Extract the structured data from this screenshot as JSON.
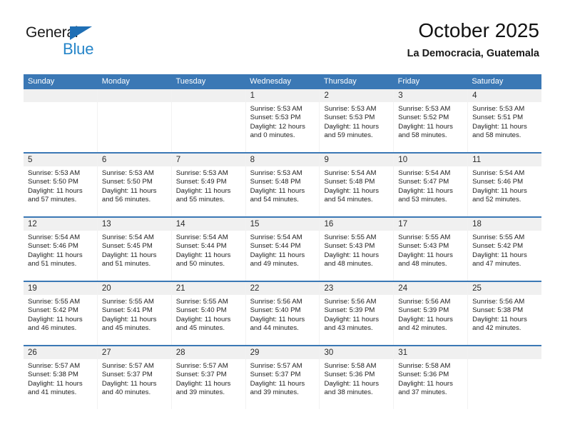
{
  "brand": {
    "name_top": "General",
    "name_bottom": "Blue",
    "color_dark": "#1b1b1b",
    "color_blue": "#2585c9",
    "triangle_color": "#1f6fb5"
  },
  "header": {
    "month_title": "October 2025",
    "location": "La Democracia, Guatemala"
  },
  "theme": {
    "header_band": "#3b78b5",
    "cell_head": "#f0f0f0",
    "cell_body": "#ffffff",
    "week_divider": "#3b78b5"
  },
  "calendar": {
    "weekday_headers": [
      "Sunday",
      "Monday",
      "Tuesday",
      "Wednesday",
      "Thursday",
      "Friday",
      "Saturday"
    ],
    "weeks": [
      [
        {
          "day": "",
          "lines": []
        },
        {
          "day": "",
          "lines": []
        },
        {
          "day": "",
          "lines": []
        },
        {
          "day": "1",
          "lines": [
            "Sunrise: 5:53 AM",
            "Sunset: 5:53 PM",
            "Daylight: 12 hours",
            "and 0 minutes."
          ]
        },
        {
          "day": "2",
          "lines": [
            "Sunrise: 5:53 AM",
            "Sunset: 5:53 PM",
            "Daylight: 11 hours",
            "and 59 minutes."
          ]
        },
        {
          "day": "3",
          "lines": [
            "Sunrise: 5:53 AM",
            "Sunset: 5:52 PM",
            "Daylight: 11 hours",
            "and 58 minutes."
          ]
        },
        {
          "day": "4",
          "lines": [
            "Sunrise: 5:53 AM",
            "Sunset: 5:51 PM",
            "Daylight: 11 hours",
            "and 58 minutes."
          ]
        }
      ],
      [
        {
          "day": "5",
          "lines": [
            "Sunrise: 5:53 AM",
            "Sunset: 5:50 PM",
            "Daylight: 11 hours",
            "and 57 minutes."
          ]
        },
        {
          "day": "6",
          "lines": [
            "Sunrise: 5:53 AM",
            "Sunset: 5:50 PM",
            "Daylight: 11 hours",
            "and 56 minutes."
          ]
        },
        {
          "day": "7",
          "lines": [
            "Sunrise: 5:53 AM",
            "Sunset: 5:49 PM",
            "Daylight: 11 hours",
            "and 55 minutes."
          ]
        },
        {
          "day": "8",
          "lines": [
            "Sunrise: 5:53 AM",
            "Sunset: 5:48 PM",
            "Daylight: 11 hours",
            "and 54 minutes."
          ]
        },
        {
          "day": "9",
          "lines": [
            "Sunrise: 5:54 AM",
            "Sunset: 5:48 PM",
            "Daylight: 11 hours",
            "and 54 minutes."
          ]
        },
        {
          "day": "10",
          "lines": [
            "Sunrise: 5:54 AM",
            "Sunset: 5:47 PM",
            "Daylight: 11 hours",
            "and 53 minutes."
          ]
        },
        {
          "day": "11",
          "lines": [
            "Sunrise: 5:54 AM",
            "Sunset: 5:46 PM",
            "Daylight: 11 hours",
            "and 52 minutes."
          ]
        }
      ],
      [
        {
          "day": "12",
          "lines": [
            "Sunrise: 5:54 AM",
            "Sunset: 5:46 PM",
            "Daylight: 11 hours",
            "and 51 minutes."
          ]
        },
        {
          "day": "13",
          "lines": [
            "Sunrise: 5:54 AM",
            "Sunset: 5:45 PM",
            "Daylight: 11 hours",
            "and 51 minutes."
          ]
        },
        {
          "day": "14",
          "lines": [
            "Sunrise: 5:54 AM",
            "Sunset: 5:44 PM",
            "Daylight: 11 hours",
            "and 50 minutes."
          ]
        },
        {
          "day": "15",
          "lines": [
            "Sunrise: 5:54 AM",
            "Sunset: 5:44 PM",
            "Daylight: 11 hours",
            "and 49 minutes."
          ]
        },
        {
          "day": "16",
          "lines": [
            "Sunrise: 5:55 AM",
            "Sunset: 5:43 PM",
            "Daylight: 11 hours",
            "and 48 minutes."
          ]
        },
        {
          "day": "17",
          "lines": [
            "Sunrise: 5:55 AM",
            "Sunset: 5:43 PM",
            "Daylight: 11 hours",
            "and 48 minutes."
          ]
        },
        {
          "day": "18",
          "lines": [
            "Sunrise: 5:55 AM",
            "Sunset: 5:42 PM",
            "Daylight: 11 hours",
            "and 47 minutes."
          ]
        }
      ],
      [
        {
          "day": "19",
          "lines": [
            "Sunrise: 5:55 AM",
            "Sunset: 5:42 PM",
            "Daylight: 11 hours",
            "and 46 minutes."
          ]
        },
        {
          "day": "20",
          "lines": [
            "Sunrise: 5:55 AM",
            "Sunset: 5:41 PM",
            "Daylight: 11 hours",
            "and 45 minutes."
          ]
        },
        {
          "day": "21",
          "lines": [
            "Sunrise: 5:55 AM",
            "Sunset: 5:40 PM",
            "Daylight: 11 hours",
            "and 45 minutes."
          ]
        },
        {
          "day": "22",
          "lines": [
            "Sunrise: 5:56 AM",
            "Sunset: 5:40 PM",
            "Daylight: 11 hours",
            "and 44 minutes."
          ]
        },
        {
          "day": "23",
          "lines": [
            "Sunrise: 5:56 AM",
            "Sunset: 5:39 PM",
            "Daylight: 11 hours",
            "and 43 minutes."
          ]
        },
        {
          "day": "24",
          "lines": [
            "Sunrise: 5:56 AM",
            "Sunset: 5:39 PM",
            "Daylight: 11 hours",
            "and 42 minutes."
          ]
        },
        {
          "day": "25",
          "lines": [
            "Sunrise: 5:56 AM",
            "Sunset: 5:38 PM",
            "Daylight: 11 hours",
            "and 42 minutes."
          ]
        }
      ],
      [
        {
          "day": "26",
          "lines": [
            "Sunrise: 5:57 AM",
            "Sunset: 5:38 PM",
            "Daylight: 11 hours",
            "and 41 minutes."
          ]
        },
        {
          "day": "27",
          "lines": [
            "Sunrise: 5:57 AM",
            "Sunset: 5:37 PM",
            "Daylight: 11 hours",
            "and 40 minutes."
          ]
        },
        {
          "day": "28",
          "lines": [
            "Sunrise: 5:57 AM",
            "Sunset: 5:37 PM",
            "Daylight: 11 hours",
            "and 39 minutes."
          ]
        },
        {
          "day": "29",
          "lines": [
            "Sunrise: 5:57 AM",
            "Sunset: 5:37 PM",
            "Daylight: 11 hours",
            "and 39 minutes."
          ]
        },
        {
          "day": "30",
          "lines": [
            "Sunrise: 5:58 AM",
            "Sunset: 5:36 PM",
            "Daylight: 11 hours",
            "and 38 minutes."
          ]
        },
        {
          "day": "31",
          "lines": [
            "Sunrise: 5:58 AM",
            "Sunset: 5:36 PM",
            "Daylight: 11 hours",
            "and 37 minutes."
          ]
        },
        {
          "day": "",
          "lines": []
        }
      ]
    ]
  }
}
